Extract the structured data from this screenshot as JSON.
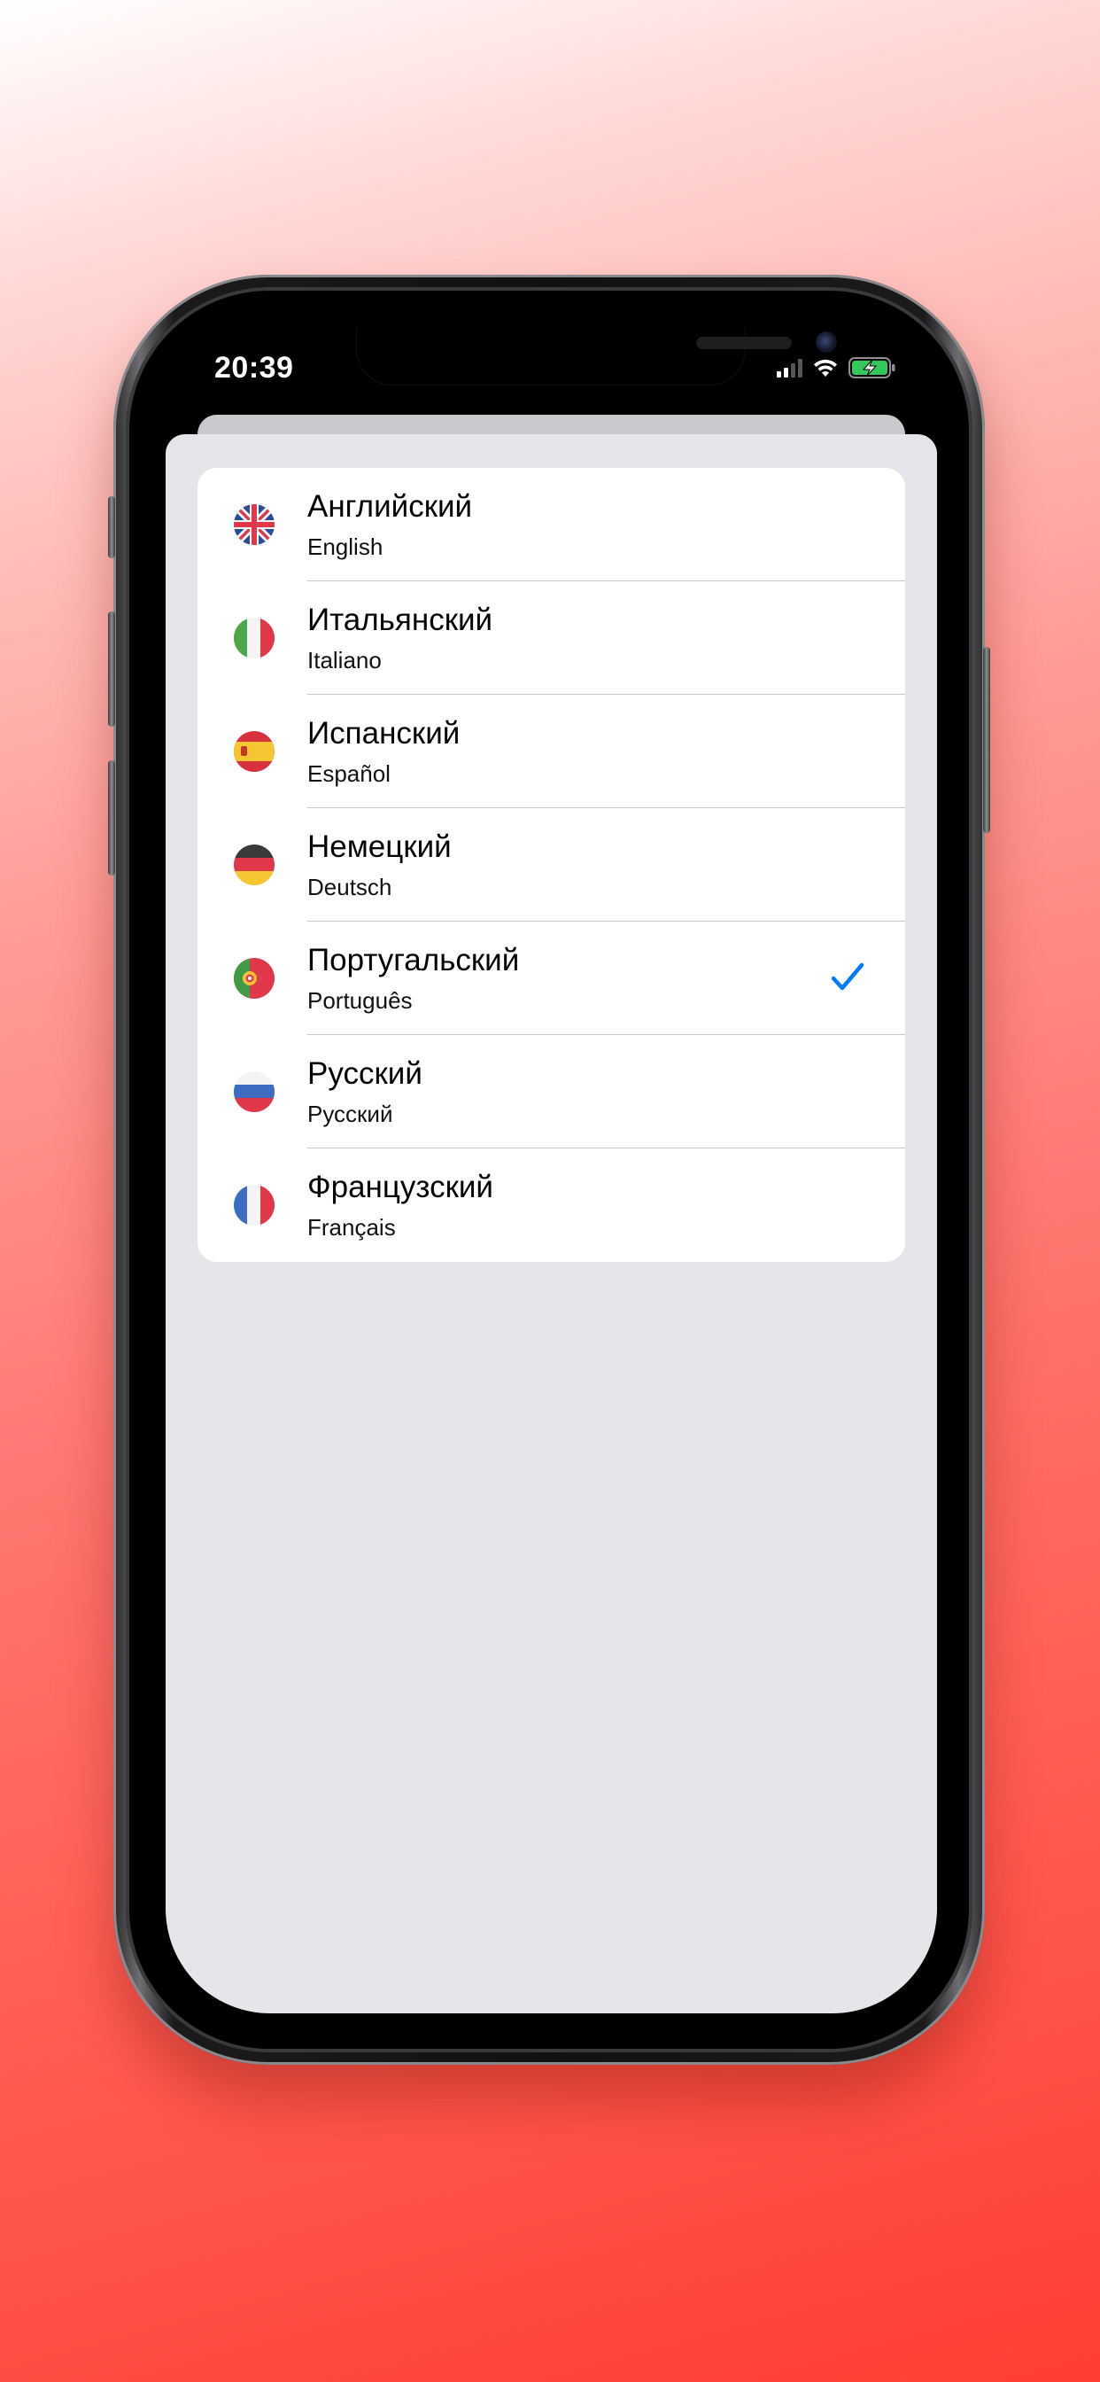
{
  "status_bar": {
    "time": "20:39",
    "icons": [
      "cellular-signal-icon",
      "wifi-icon",
      "battery-charging-icon"
    ]
  },
  "languages": [
    {
      "name": "Английский",
      "native": "English",
      "flag": "uk-flag-icon",
      "selected": false
    },
    {
      "name": "Итальянский",
      "native": "Italiano",
      "flag": "italy-flag-icon",
      "selected": false
    },
    {
      "name": "Испанский",
      "native": "Español",
      "flag": "spain-flag-icon",
      "selected": false
    },
    {
      "name": "Немецкий",
      "native": "Deutsch",
      "flag": "germany-flag-icon",
      "selected": false
    },
    {
      "name": "Португальский",
      "native": "Português",
      "flag": "portugal-flag-icon",
      "selected": true
    },
    {
      "name": "Русский",
      "native": "Русский",
      "flag": "russia-flag-icon",
      "selected": false
    },
    {
      "name": "Французский",
      "native": "Français",
      "flag": "france-flag-icon",
      "selected": false
    }
  ],
  "colors": {
    "accent": "#007aff",
    "sheet_background": "#e5e5ea",
    "battery_charging": "#34c759",
    "background_gradient_end": "#ff3e33"
  }
}
